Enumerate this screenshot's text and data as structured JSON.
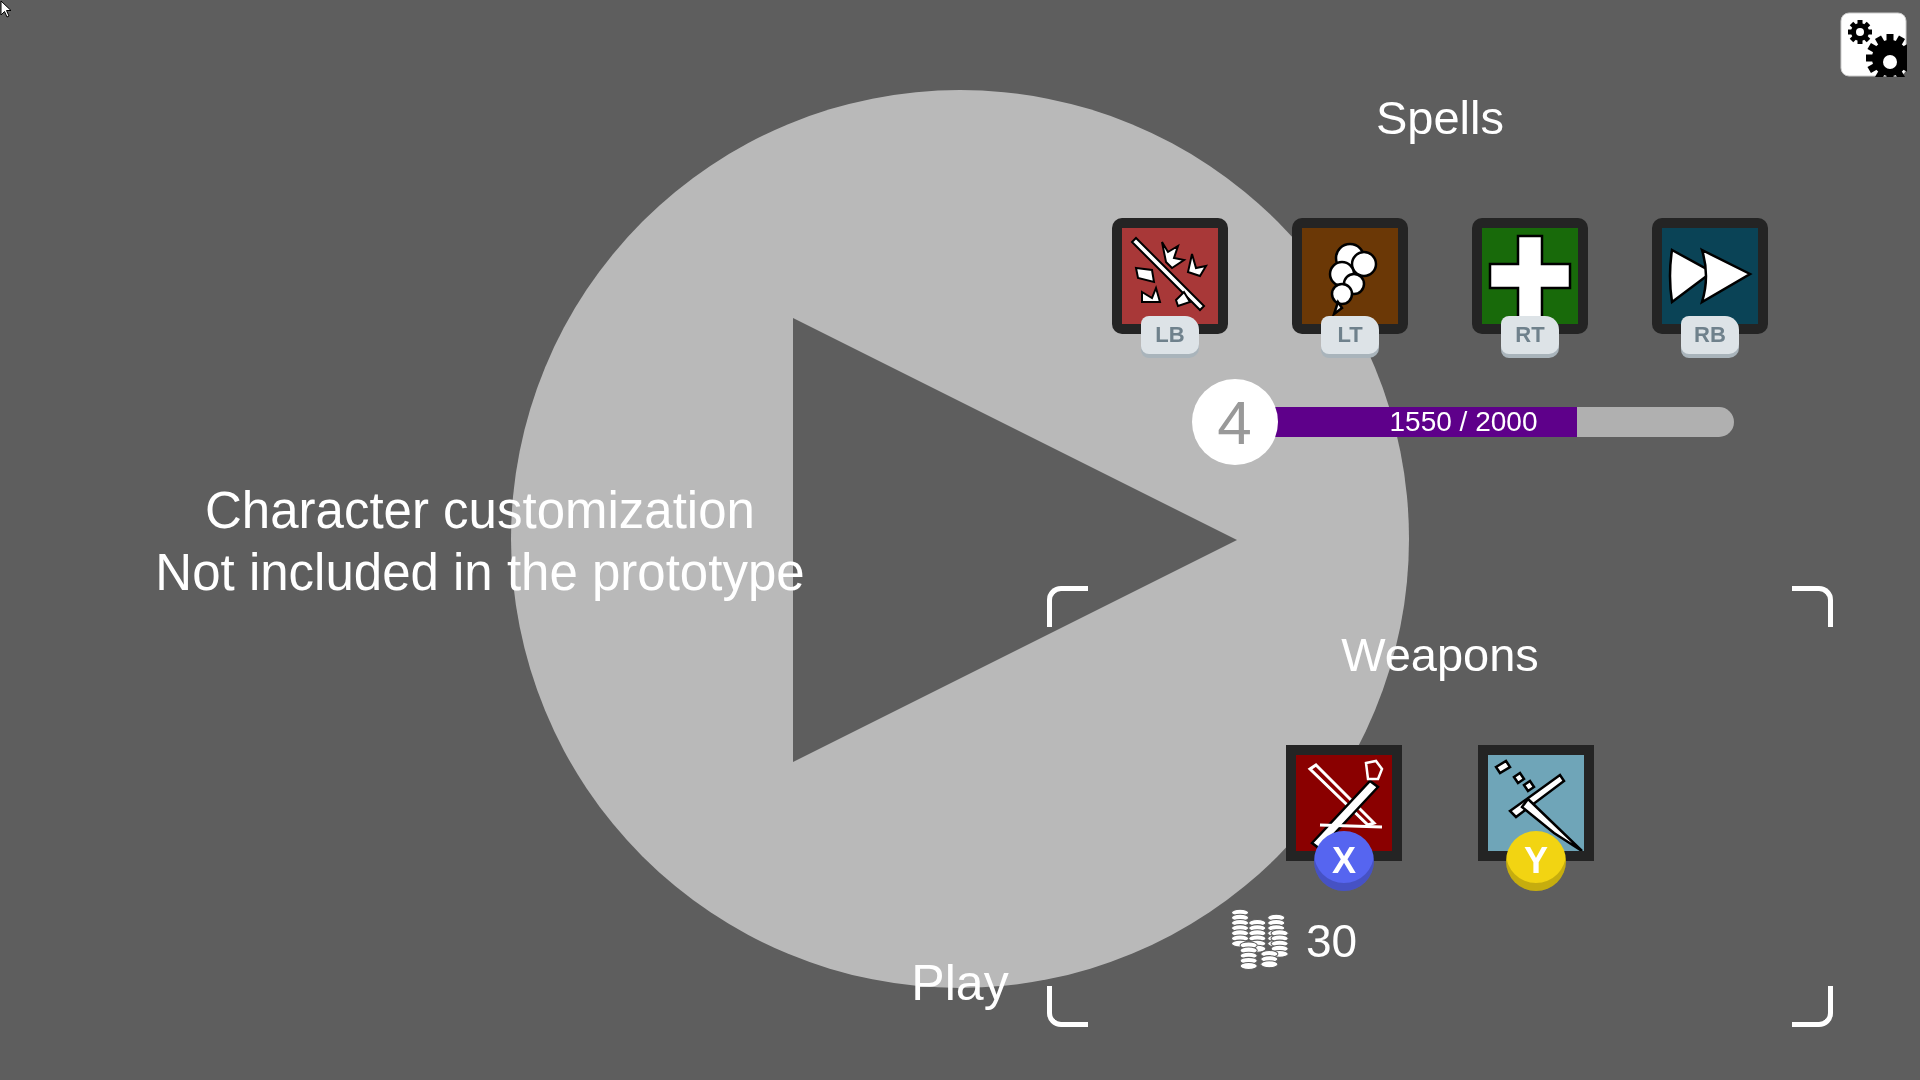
{
  "character_panel": {
    "lines": [
      "Character customization",
      "Not included in the prototype"
    ]
  },
  "play_button": {
    "label": "Play"
  },
  "spells": {
    "title": "Spells",
    "slots": [
      {
        "key": "LB",
        "color": "#a83838"
      },
      {
        "key": "LT",
        "color": "#6b3806"
      },
      {
        "key": "RT",
        "color": "#186a0a"
      },
      {
        "key": "RB",
        "color": "#0a4356"
      }
    ]
  },
  "experience": {
    "rank": "4",
    "text": "1550 / 2000",
    "level": 0.68
  },
  "weapons": {
    "title": "Weapons",
    "slots": [
      {
        "key": "X",
        "color": "#8a0000",
        "button": {
          "color": "#5665f0"
        }
      },
      {
        "key": "Y",
        "color": "#6fa5b8",
        "button": {
          "color": "#f2d412"
        }
      }
    ],
    "coins": "30"
  }
}
